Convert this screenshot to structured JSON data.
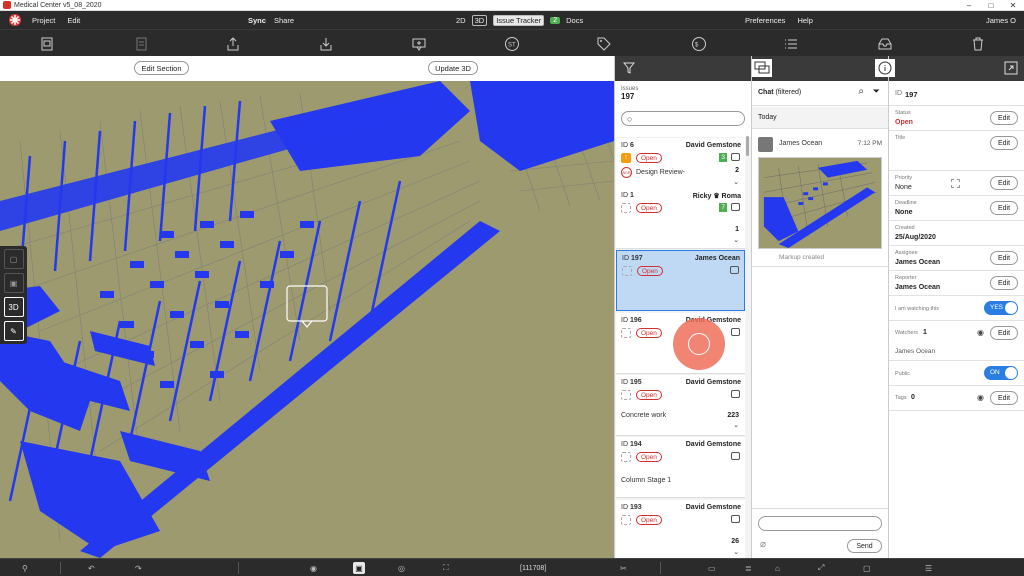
{
  "window": {
    "title": "Medical Center v5_08_2020"
  },
  "menu": {
    "project": "Project",
    "edit": "Edit",
    "sync": "Sync",
    "share": "Share",
    "view_2d": "2D",
    "view_3d": "3D",
    "issue_tracker": "Issue Tracker",
    "issue_badge": "2",
    "docs": "Docs",
    "preferences": "Preferences",
    "help": "Help",
    "user": "James O"
  },
  "toolbar_icons": [
    "clipboard-icon",
    "document-icon",
    "upload-icon",
    "download-icon",
    "comment-icon",
    "st-icon",
    "tag-icon",
    "issue-count-icon",
    "list-icon",
    "inbox-icon",
    "trash-icon"
  ],
  "viewer": {
    "edit_section": "Edit Section",
    "update_3d": "Update 3D",
    "side_tool_3d": "3D"
  },
  "issues": {
    "label": "Issues",
    "count": "197",
    "search_glyph": "○",
    "items": [
      {
        "id_label": "ID",
        "id": "6",
        "assignee": "David Gemstone",
        "status": "Open",
        "comments": "3",
        "desc": "Design Review-",
        "num": "2",
        "asr": "ASR",
        "priority_icon": "↑"
      },
      {
        "id_label": "ID",
        "id": "1",
        "assignee": "Ricky ♛ Roma",
        "status": "Open",
        "comments": "7",
        "desc": "",
        "num": "1"
      },
      {
        "id_label": "ID",
        "id": "197",
        "assignee": "James Ocean",
        "status": "Open",
        "comments": "",
        "desc": "",
        "num": ""
      },
      {
        "id_label": "ID",
        "id": "196",
        "assignee": "David Gemstone",
        "status": "Open",
        "comments": "",
        "desc": "",
        "num": ""
      },
      {
        "id_label": "ID",
        "id": "195",
        "assignee": "David Gemstone",
        "status": "Open",
        "comments": "",
        "desc": "Concrete work",
        "num": "223"
      },
      {
        "id_label": "ID",
        "id": "194",
        "assignee": "David Gemstone",
        "status": "Open",
        "comments": "",
        "desc": "Column Stage 1",
        "num": ""
      },
      {
        "id_label": "ID",
        "id": "193",
        "assignee": "David Gemstone",
        "status": "Open",
        "comments": "",
        "desc": "",
        "num": "26"
      }
    ]
  },
  "chat": {
    "title": "Chat",
    "filter": "(filtered)",
    "today": "Today",
    "message": {
      "author": "James Ocean",
      "time": "7:12 PM",
      "caption": "Markup created"
    },
    "send": "Send"
  },
  "details": {
    "id_label": "ID",
    "id": "197",
    "status_label": "Status",
    "status": "Open",
    "title_label": "Title",
    "priority_label": "Priority",
    "priority": "None",
    "deadline_label": "Deadline",
    "deadline": "None",
    "created_label": "Created",
    "created": "25/Aug/2020",
    "assignee_label": "Assignee",
    "assignee": "James Ocean",
    "reporter_label": "Reporter",
    "reporter": "James Ocean",
    "watching_label": "I am watching this",
    "watching_toggle": "YES",
    "watchers_label": "Watchers",
    "watchers_count": "1",
    "watcher_name": "James Ocean",
    "public_label": "Public",
    "public_toggle": "ON",
    "tags_label": "Tags",
    "tags_count": "0",
    "edit": "Edit"
  },
  "statusbar": {
    "counter": "[111708]"
  }
}
